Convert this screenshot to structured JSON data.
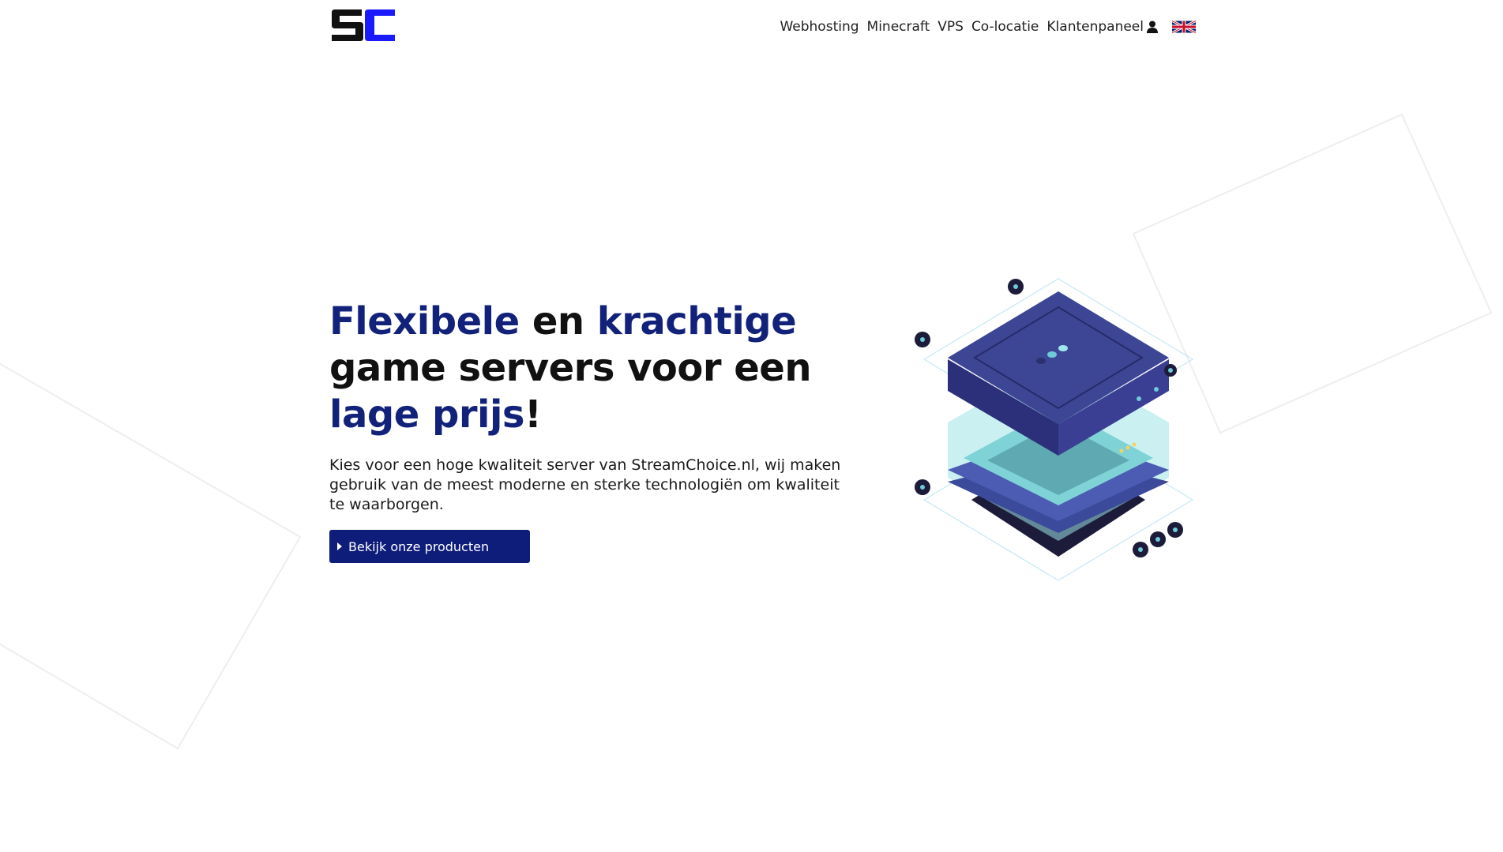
{
  "brand": {
    "logo_text": "SC"
  },
  "nav": {
    "items": [
      {
        "label": "Webhosting"
      },
      {
        "label": "Minecraft"
      },
      {
        "label": "VPS"
      },
      {
        "label": "Co-locatie"
      }
    ],
    "panel_label": "Klantenpaneel",
    "language_icon": "uk-flag-icon",
    "user_icon": "user-icon"
  },
  "hero": {
    "title_parts": [
      "Flexibele",
      " en ",
      "krachtige",
      " game servers voor een ",
      "lage prijs",
      "!"
    ],
    "description": "Kies voor een hoge kwaliteit server van StreamChoice.nl, wij maken gebruik van de meest moderne en sterke technologiën om kwaliteit te waarborgen.",
    "cta_label": "Bekijk onze producten",
    "cta_icon": "caret-right-icon"
  },
  "colors": {
    "accent": "#12227a",
    "button": "#0f1d7a",
    "logo_blue": "#1a1aff",
    "logo_dark": "#111111"
  }
}
